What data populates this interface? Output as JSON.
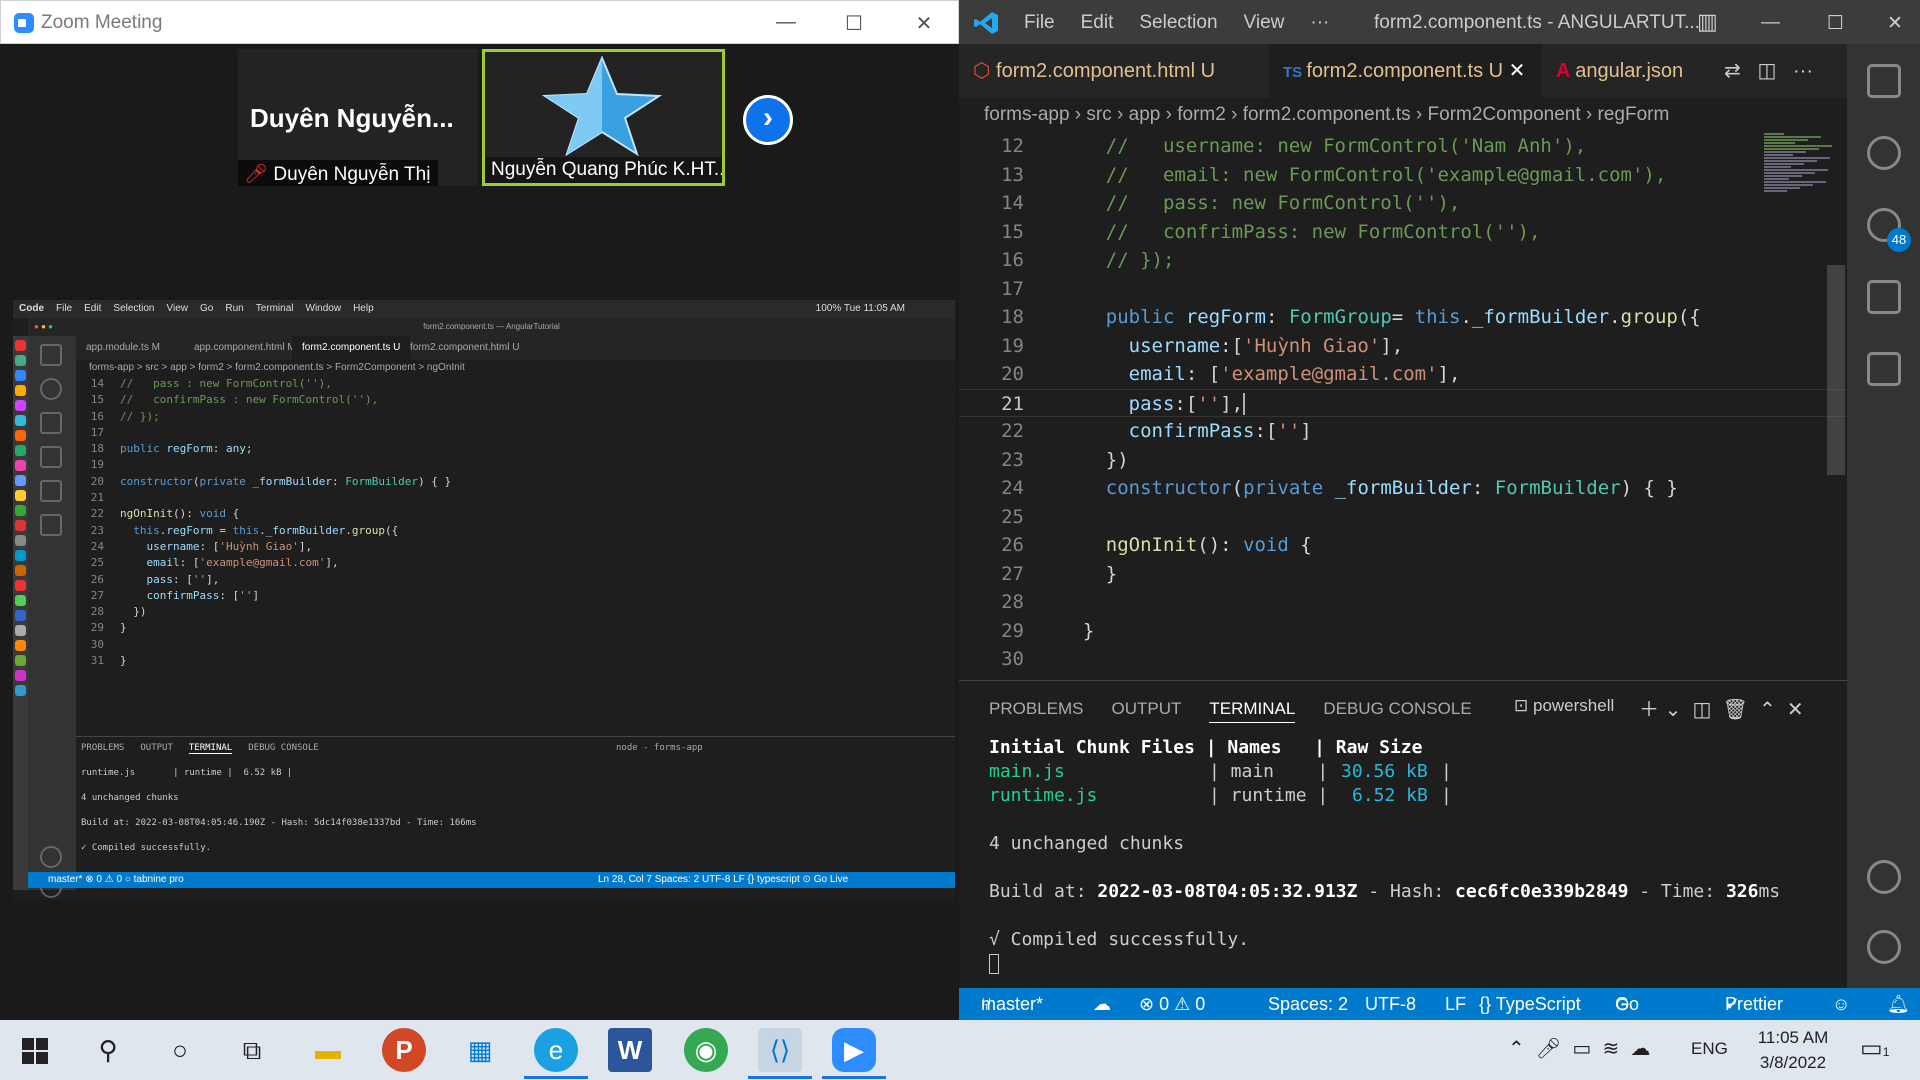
{
  "zoom": {
    "title": "Zoom Meeting",
    "participant1_big": "Duyên  Nguyễn...",
    "participant1_label": "Duyên Nguyễn Thị",
    "participant2_label": "Nguyễn Quang Phúc K.HT...",
    "next_icon": "chevron-right-icon"
  },
  "mac": {
    "menu": [
      "Code",
      "File",
      "Edit",
      "Selection",
      "View",
      "Go",
      "Run",
      "Terminal",
      "Window",
      "Help"
    ],
    "menu_right": "100%  Tue 11:05 AM",
    "title": "form2.component.ts — AngularTutorial",
    "tabs": [
      {
        "label": "app.module.ts",
        "badge": "M"
      },
      {
        "label": "app.component.html",
        "badge": "M"
      },
      {
        "label": "form2.component.ts",
        "badge": "U"
      },
      {
        "label": "form2.component.html",
        "badge": "U"
      }
    ],
    "breadcrumb": "forms-app > src > app > form2 > form2.component.ts > Form2Component > ngOnInit",
    "lines": [
      {
        "n": "14",
        "t": "//   pass : new FormControl(''),",
        "k": "c-cm"
      },
      {
        "n": "15",
        "t": "//   confirmPass : new FormControl(''),",
        "k": "c-cm"
      },
      {
        "n": "16",
        "t": "// });",
        "k": "c-cm"
      },
      {
        "n": "17",
        "t": "",
        "k": ""
      },
      {
        "n": "18",
        "t": "public regForm: any;",
        "k": ""
      },
      {
        "n": "19",
        "t": "",
        "k": ""
      },
      {
        "n": "20",
        "t": "constructor(private _formBuilder: FormBuilder) { }",
        "k": ""
      },
      {
        "n": "21",
        "t": "",
        "k": ""
      },
      {
        "n": "22",
        "t": "ngOnInit(): void {",
        "k": ""
      },
      {
        "n": "23",
        "t": "  this.regForm = this._formBuilder.group({",
        "k": ""
      },
      {
        "n": "24",
        "t": "    username: ['Huỳnh Giao'],",
        "k": ""
      },
      {
        "n": "25",
        "t": "    email: ['example@gmail.com'],",
        "k": ""
      },
      {
        "n": "26",
        "t": "    pass: [''],",
        "k": ""
      },
      {
        "n": "27",
        "t": "    confirmPass: ['']",
        "k": ""
      },
      {
        "n": "28",
        "t": "  })",
        "k": ""
      },
      {
        "n": "29",
        "t": "}",
        "k": ""
      },
      {
        "n": "30",
        "t": "",
        "k": ""
      },
      {
        "n": "31",
        "t": "}",
        "k": ""
      }
    ],
    "panel_tabs": [
      "PROBLEMS",
      "OUTPUT",
      "TERMINAL",
      "DEBUG CONSOLE"
    ],
    "panel_right": "node - forms-app",
    "term": [
      "runtime.js       | runtime |  6.52 kB |",
      "",
      "4 unchanged chunks",
      "",
      "Build at: 2022-03-08T04:05:46.190Z - Hash: 5dc14f038e1337bd - Time: 166ms",
      "",
      "✓ Compiled successfully."
    ],
    "status_left": "master*   ⊗ 0 ⚠ 0   ○ tabnine pro",
    "status_right": "Ln 28, Col 7   Spaces: 2   UTF-8   LF   {} typescript   ⊙ Go Live"
  },
  "vs": {
    "menu": [
      "File",
      "Edit",
      "Selection",
      "View",
      "···"
    ],
    "title": "form2.component.ts - ANGULARTUT...",
    "tabs": [
      {
        "label": "form2.component.html",
        "badge": "U",
        "active": false
      },
      {
        "label": "form2.component.ts",
        "badge": "U",
        "active": true
      },
      {
        "label": "angular.json",
        "badge": "",
        "active": false
      }
    ],
    "breadcrumb": [
      "forms-app",
      "src",
      "app",
      "form2",
      "form2.component.ts",
      "Form2Component",
      "regForm"
    ],
    "activity_badge": "48",
    "lines": [
      {
        "n": "12",
        "t": "    //   username: new FormControl('Nam Anh'),",
        "k": "c-cm"
      },
      {
        "n": "13",
        "t": "    //   email: new FormControl('example@gmail.com'),",
        "k": "c-cm"
      },
      {
        "n": "14",
        "t": "    //   pass: new FormControl(''),",
        "k": "c-cm"
      },
      {
        "n": "15",
        "t": "    //   confrimPass: new FormControl(''),",
        "k": "c-cm"
      },
      {
        "n": "16",
        "t": "    // });",
        "k": "c-cm"
      },
      {
        "n": "17",
        "t": "",
        "k": ""
      },
      {
        "n": "18",
        "t": "    public regForm: FormGroup= this._formBuilder.group({",
        "k": ""
      },
      {
        "n": "19",
        "t": "      username:['Huỳnh Giao'],",
        "k": ""
      },
      {
        "n": "20",
        "t": "      email: ['example@gmail.com'],",
        "k": ""
      },
      {
        "n": "21",
        "t": "      pass:[''],",
        "k": ""
      },
      {
        "n": "22",
        "t": "      confirmPass:['']",
        "k": ""
      },
      {
        "n": "23",
        "t": "    })",
        "k": ""
      },
      {
        "n": "24",
        "t": "    constructor(private _formBuilder: FormBuilder) { }",
        "k": ""
      },
      {
        "n": "25",
        "t": "",
        "k": ""
      },
      {
        "n": "26",
        "t": "    ngOnInit(): void {",
        "k": ""
      },
      {
        "n": "27",
        "t": "    }",
        "k": ""
      },
      {
        "n": "28",
        "t": "",
        "k": ""
      },
      {
        "n": "29",
        "t": "  }",
        "k": ""
      },
      {
        "n": "30",
        "t": "",
        "k": ""
      }
    ],
    "current_line": "21",
    "panel_tabs": [
      "PROBLEMS",
      "OUTPUT",
      "TERMINAL",
      "DEBUG CONSOLE"
    ],
    "shell": "powershell",
    "term": {
      "header": "Initial Chunk Files | Names   | Raw Size",
      "row1": [
        "main.js",
        "| main    |",
        "30.56 kB",
        "|"
      ],
      "row2": [
        "runtime.js",
        "| runtime |",
        "6.52 kB",
        "|"
      ],
      "unchanged": "4 unchanged chunks",
      "build_prefix": "Build at: ",
      "build_date": "2022-03-08T04:05:32.913Z",
      "hash_prefix": " - Hash: ",
      "hash": "cec6fc0e339b2849",
      "time_prefix": " - Time: ",
      "time": "326",
      "time_unit": "ms",
      "compiled": "√ Compiled successfully."
    },
    "status": {
      "branch": "master*",
      "errors": "⊗ 0 ⚠ 0",
      "spaces": "Spaces: 2",
      "enc": "UTF-8",
      "eol": "LF",
      "lang": "{} TypeScript",
      "golive": "Go Live",
      "prettier": "Prettier"
    }
  },
  "taskbar": {
    "time": "11:05 AM",
    "date": "3/8/2022",
    "lang": "ENG",
    "notif": "1"
  },
  "colors": {
    "accent": "#007acc",
    "zoom": "#2d8cff",
    "speaker_border": "#9acd32"
  }
}
